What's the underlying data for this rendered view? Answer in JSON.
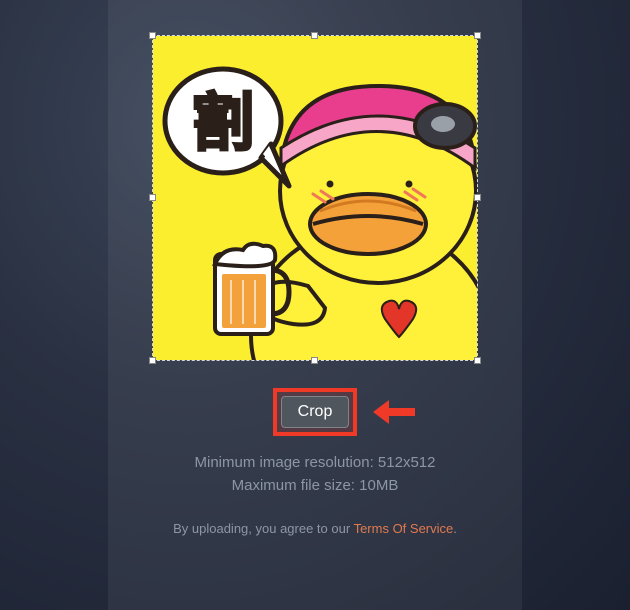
{
  "crop": {
    "button_label": "Crop"
  },
  "info": {
    "min_resolution": "Minimum image resolution: 512x512",
    "max_filesize": "Maximum file size: 10MB"
  },
  "agreement": {
    "prefix": "By uploading, you agree to our ",
    "link_text": "Terms Of Service",
    "suffix": "."
  },
  "image": {
    "speech_character": "割"
  },
  "colors": {
    "highlight": "#f03a27",
    "link": "#e07a4f"
  }
}
